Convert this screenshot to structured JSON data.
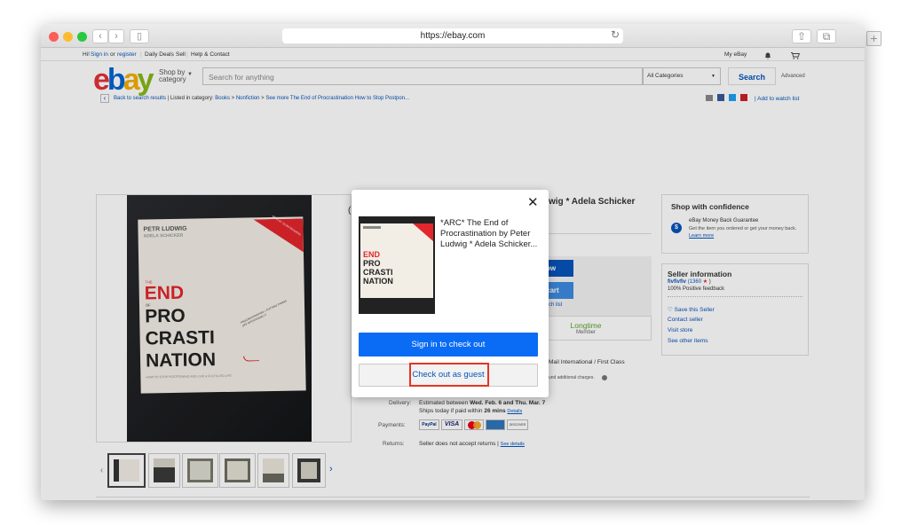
{
  "browser": {
    "url": "https://ebay.com",
    "back_icon": "‹",
    "forward_icon": "›",
    "sidebar_icon": "▯",
    "reload_icon": "↻",
    "share_icon": "⇧",
    "tabs_icon": "⧉",
    "new_tab_icon": "+"
  },
  "topbar": {
    "greeting": "Hi!",
    "sign_in": "Sign in",
    "or": "or",
    "register": "register",
    "daily_deals": "Daily Deals",
    "sell": "Sell",
    "help": "Help & Contact",
    "my_ebay": "My eBay"
  },
  "header": {
    "logo": "ebay",
    "shop_by_line1": "Shop by",
    "shop_by_line2": "category",
    "search_placeholder": "Search for anything",
    "categories": "All Categories",
    "search_button": "Search",
    "advanced": "Advanced"
  },
  "breadcrumb": {
    "back": "Back to search results",
    "listed": "| Listed in category:",
    "books": "Books",
    "nonfiction": "Nonfiction",
    "see_more": "See more The End of Procrastination How to Stop Postpon...",
    "watch": "| Add to watch list"
  },
  "cover": {
    "author1": "PETR LUDWIG",
    "author2": "ADELA SCHICKER",
    "the": "THE",
    "end": "END",
    "of": "OF",
    "pro": "PRO",
    "crasti": "CRASTI",
    "nation": "NATION",
    "subtitle": "HOW TO STOP POSTPONING AND LIVE A FULFILLED LIFE",
    "sticker": "READ BY 18,000 READERS",
    "scribble": "PROCRASTINATION = PUTTING THINGS OFF INTENTIONALLY"
  },
  "listing": {
    "title_fragment": "wig * Adela Schicker",
    "paren": "(",
    "buy_now": "ow",
    "add_cart": "cart",
    "watch": "ch list",
    "longtime": "Longtime",
    "member": "Member",
    "shipping_fragment": "Mail International / First Class",
    "charges": "und additional charges.",
    "delivery_label": "Delivery:",
    "delivery_pre": "Estimated between",
    "delivery_dates": "Wed. Feb. 6 and Thu. Mar. 7",
    "ships_pre": "Ships today if paid within",
    "ships_time": "26 mins",
    "details": "Details",
    "payments_label": "Payments:",
    "paypal": "PayPal",
    "visa": "VISA",
    "discover": "DISCOVER",
    "returns_label": "Returns:",
    "returns_text": "Seller does not accept returns |",
    "see_details": "See details"
  },
  "confidence": {
    "title": "Shop with confidence",
    "guarantee": "eBay Money Back Guarantee",
    "desc": "Get the item you ordered or get your money back.",
    "learn_more": "Learn more"
  },
  "seller": {
    "title": "Seller information",
    "name": "fivfivfiv",
    "score": "(1360",
    "star": "★",
    "close_paren": ")",
    "feedback": "100% Positive feedback",
    "save": "Save this Seller",
    "contact": "Contact seller",
    "store": "Visit store",
    "other": "See other items"
  },
  "modal": {
    "close": "✕",
    "title": "*ARC* The End of Procrastination by Peter Ludwig * Adela Schicker...",
    "sign_in": "Sign in to check out",
    "guest": "Check out as guest",
    "thumb_end": "END",
    "thumb_pro": "PRO",
    "thumb_crasti": "CRASTI",
    "thumb_nation": "NATION"
  },
  "colors": {
    "primary": "#0a6cf5",
    "highlight": "#e53424",
    "ebay_red": "#e53238",
    "ebay_blue": "#0064d2",
    "ebay_yellow": "#f5af02",
    "ebay_green": "#86b817"
  }
}
